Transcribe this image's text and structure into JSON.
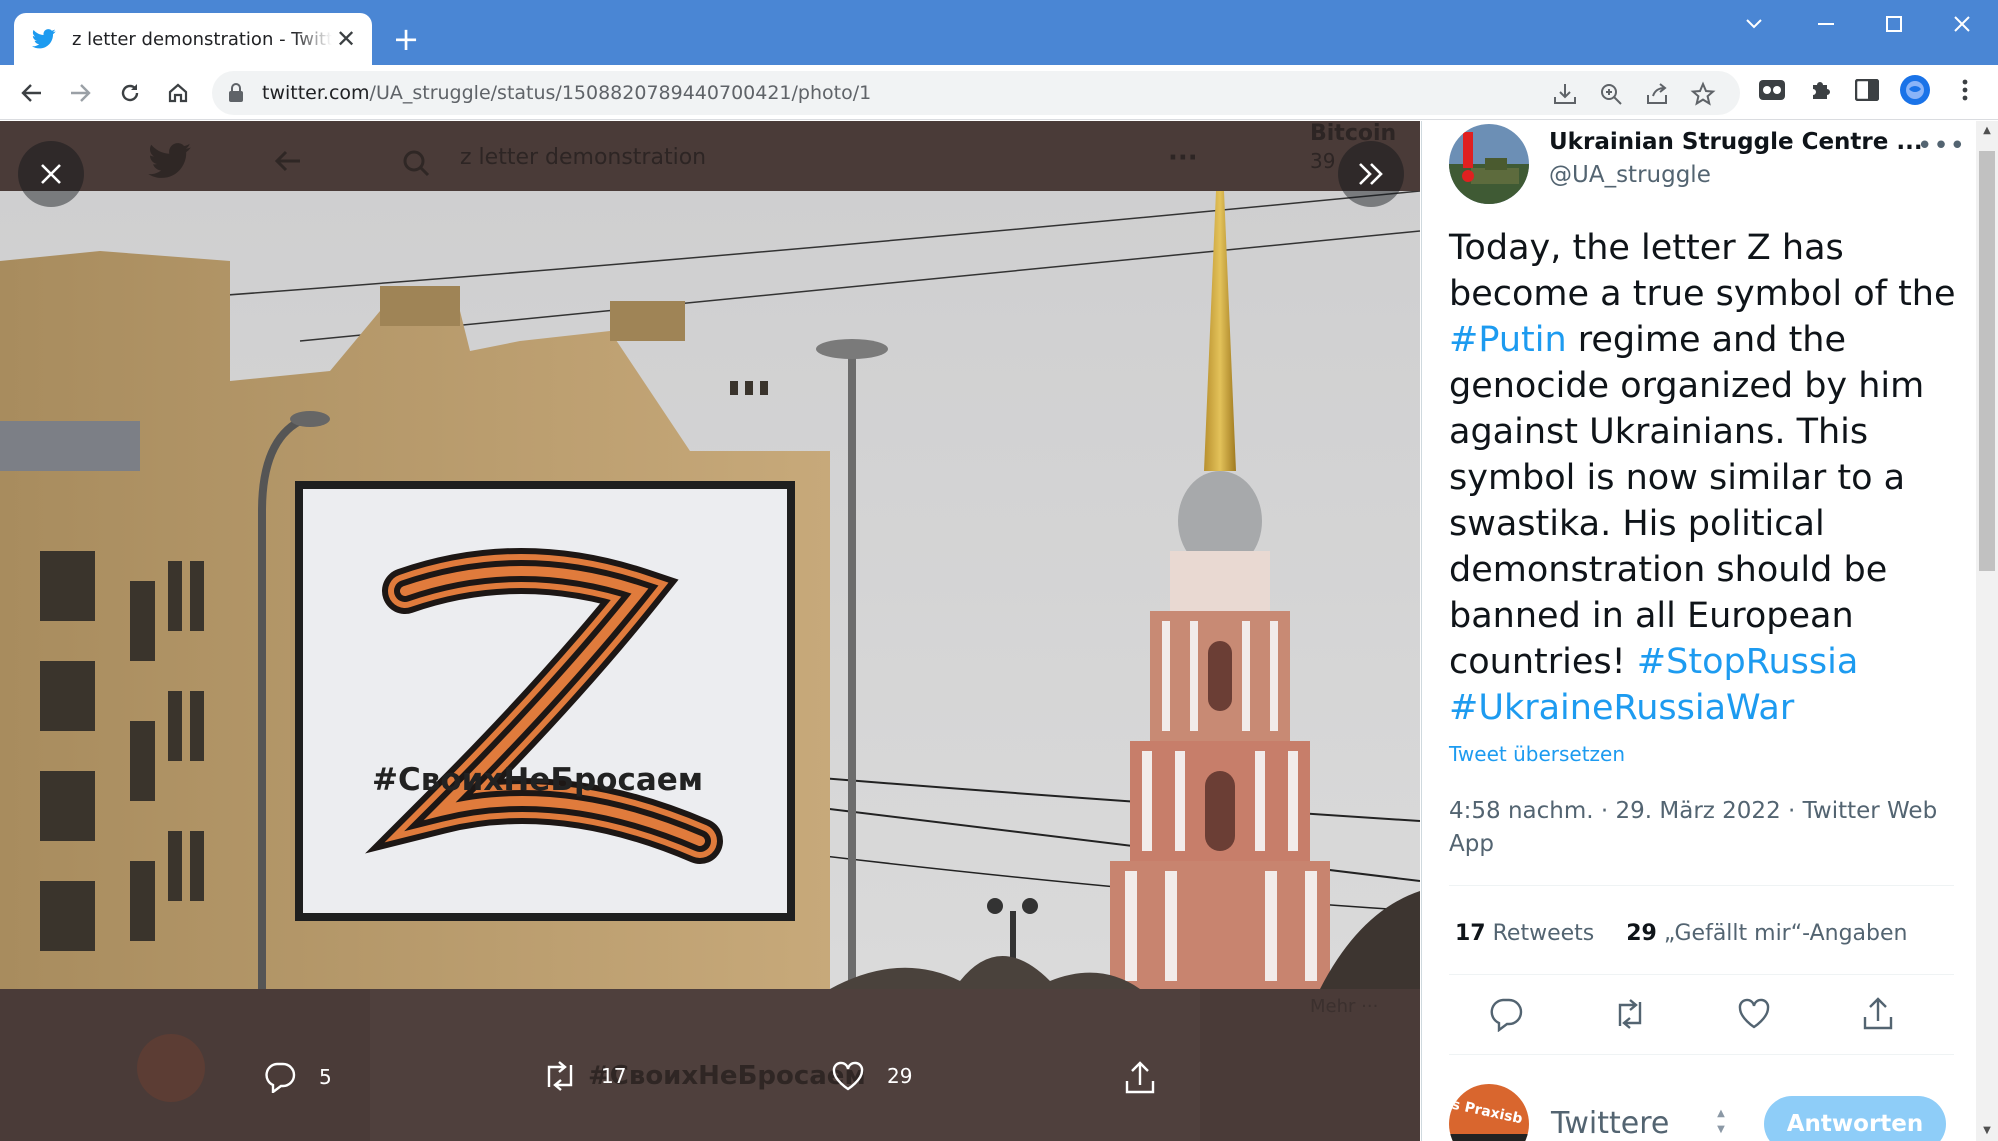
{
  "browser": {
    "tab_title": "z letter demonstration - Twitter S",
    "url_host": "twitter.com",
    "url_path": "/UA_struggle/status/1508820789440700421/photo/1"
  },
  "media_view": {
    "background": {
      "search_text": "z letter demonstration",
      "trend_title": "Bitcoin",
      "trend_count": "39",
      "more_text": "Mehr ···",
      "billboard_text": "#СвоихНеБросаем"
    },
    "photo": {
      "billboard_hashtag": "#СвоихНеБросаем"
    },
    "actions": {
      "replies": "5",
      "retweets": "17",
      "likes": "29"
    }
  },
  "tweet": {
    "author_name": "Ukrainian Struggle Centre ...",
    "author_handle": "@UA_struggle",
    "text": {
      "part1": "Today, the letter Z has become a true symbol of the ",
      "tag_putin": "#Putin",
      "part2": " regime and the genocide organized by him against Ukrainians. This symbol is now similar to a swastika. His political demonstration should be banned in all European countries! ",
      "tag_stoprussia": "#StopRussia",
      "tag_war": "#UkraineRussiaWar"
    },
    "translate_link": "Tweet übersetzen",
    "timestamp": "4:58 nachm. · 29. März 2022 · Twitter Web App",
    "retweet_count": "17",
    "retweet_label": "Retweets",
    "like_count": "29",
    "like_label": "„Gefällt mir“-Angaben",
    "reply_placeholder": "Twittere",
    "reply_button": "Antworten",
    "reply_avatar_text": "s Praxisb"
  },
  "colors": {
    "chrome_blue": "#4a86d4",
    "twitter_blue": "#1d9bf0",
    "reply_button_disabled": "#8ecdf8"
  }
}
